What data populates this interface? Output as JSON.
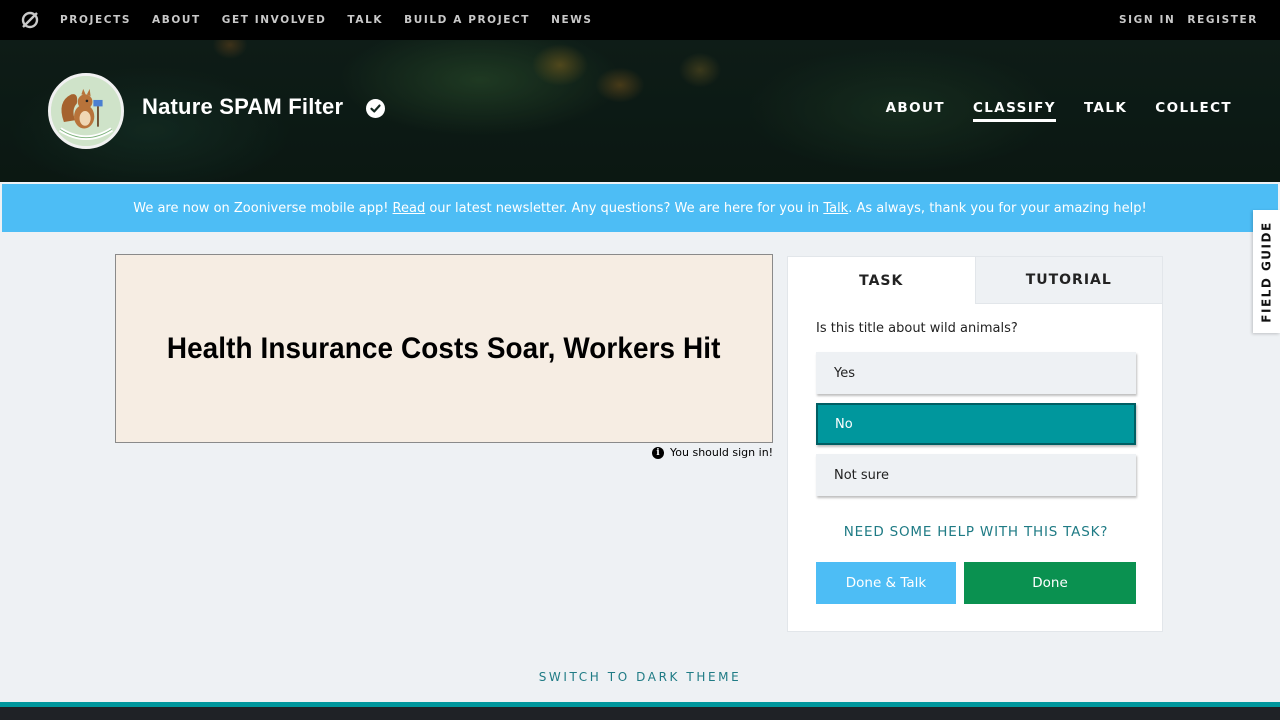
{
  "topbar": {
    "nav": [
      "PROJECTS",
      "ABOUT",
      "GET INVOLVED",
      "TALK",
      "BUILD A PROJECT",
      "NEWS"
    ],
    "sign_in": "SIGN IN",
    "register": "REGISTER"
  },
  "project": {
    "title": "Nature SPAM Filter",
    "nav": {
      "about": "ABOUT",
      "classify": "CLASSIFY",
      "talk": "TALK",
      "collect": "COLLECT"
    }
  },
  "announcement": {
    "part1": "We are now on Zooniverse mobile app! ",
    "link1": "Read",
    "part2": " our latest newsletter. Any questions? We are here for you in ",
    "link2": "Talk",
    "part3": ". As always, thank you for your amazing help!"
  },
  "subject": {
    "title": "Health Insurance Costs Soar, Workers Hit",
    "signin_note": "You should sign in!"
  },
  "task_panel": {
    "tab_task": "TASK",
    "tab_tutorial": "TUTORIAL",
    "question": "Is this title about wild animals?",
    "answers": [
      "Yes",
      "No",
      "Not sure"
    ],
    "selected_answer": "No",
    "help_link": "NEED SOME HELP WITH THIS TASK?",
    "done_talk": "Done & Talk",
    "done": "Done"
  },
  "field_guide": "FIELD GUIDE",
  "theme_switch": "SWITCH TO DARK THEME",
  "colors": {
    "accent_teal": "#00979d",
    "announcement_blue": "#4dbdf5",
    "done_green": "#0a9150"
  }
}
